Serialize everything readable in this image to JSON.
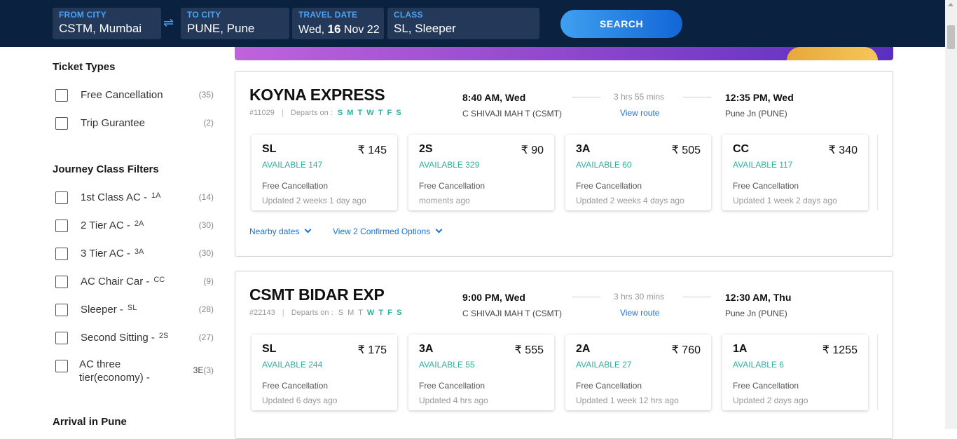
{
  "search": {
    "from": {
      "label": "FROM CITY",
      "value": "CSTM, Mumbai"
    },
    "to": {
      "label": "TO CITY",
      "value": "PUNE, Pune"
    },
    "date": {
      "label": "TRAVEL DATE",
      "prefix": "Wed,",
      "day": "16",
      "suffix": "Nov 22"
    },
    "class": {
      "label": "CLASS",
      "value": "SL, Sleeper"
    },
    "swap_icon": "⇌",
    "button_label": "SEARCH"
  },
  "filters": {
    "ticket_types": {
      "title": "Ticket Types",
      "items": [
        {
          "label": "Free Cancellation",
          "count": "(35)"
        },
        {
          "label": "Trip Gurantee",
          "count": "(2)"
        }
      ]
    },
    "journey_class": {
      "title": "Journey Class Filters",
      "items": [
        {
          "label": "1st Class AC -",
          "code": "1A",
          "count": "(14)"
        },
        {
          "label": "2 Tier AC -",
          "code": "2A",
          "count": "(30)"
        },
        {
          "label": "3 Tier AC -",
          "code": "3A",
          "count": "(30)"
        },
        {
          "label": "AC Chair Car -",
          "code": "CC",
          "count": "(9)"
        },
        {
          "label": "Sleeper -",
          "code": "SL",
          "count": "(28)"
        },
        {
          "label": "Second Sitting -",
          "code": "2S",
          "count": "(27)"
        },
        {
          "label_line1": "AC three",
          "label_line2": "tier(economy) -",
          "code": "3E",
          "count": "(3)"
        }
      ]
    },
    "arrival": {
      "title": "Arrival in Pune"
    }
  },
  "trains": [
    {
      "name": "KOYNA EXPRESS",
      "number": "#11029",
      "separator": "|",
      "departs_label": "Departs on :",
      "days": [
        "S",
        "M",
        "T",
        "W",
        "T",
        "F",
        "S"
      ],
      "days_running": [
        true,
        true,
        true,
        true,
        true,
        true,
        true
      ],
      "dep_time": "8:40 AM, Wed",
      "dep_station": "C SHIVAJI MAH T (CSMT)",
      "duration": "3 hrs 55 mins",
      "view_route": "View route",
      "arr_time": "12:35 PM, Wed",
      "arr_station": "Pune Jn (PUNE)",
      "classes": [
        {
          "name": "SL",
          "price": "₹ 145",
          "availability": "AVAILABLE 147",
          "cancellation": "Free Cancellation",
          "updated": "Updated 2 weeks 1 day ago"
        },
        {
          "name": "2S",
          "price": "₹ 90",
          "availability": "AVAILABLE 329",
          "cancellation": "Free Cancellation",
          "updated": "moments ago"
        },
        {
          "name": "3A",
          "price": "₹ 505",
          "availability": "AVAILABLE 60",
          "cancellation": "Free Cancellation",
          "updated": "Updated 2 weeks 4 days ago"
        },
        {
          "name": "CC",
          "price": "₹ 340",
          "availability": "AVAILABLE 117",
          "cancellation": "Free Cancellation",
          "updated": "Updated 1 week 2 days ago"
        }
      ],
      "nearby_dates": "Nearby dates",
      "confirmed_options": "View 2 Confirmed Options"
    },
    {
      "name": "CSMT BIDAR EXP",
      "number": "#22143",
      "separator": "|",
      "departs_label": "Departs on :",
      "days": [
        "S",
        "M",
        "T",
        "W",
        "T",
        "F",
        "S"
      ],
      "days_running": [
        false,
        false,
        false,
        true,
        false,
        false,
        false
      ],
      "dep_time": "9:00 PM, Wed",
      "dep_station": "C SHIVAJI MAH T (CSMT)",
      "duration": "3 hrs 30 mins",
      "view_route": "View route",
      "arr_time": "12:30 AM, Thu",
      "arr_station": "Pune Jn (PUNE)",
      "classes": [
        {
          "name": "SL",
          "price": "₹ 175",
          "availability": "AVAILABLE 244",
          "cancellation": "Free Cancellation",
          "updated": "Updated 6 days ago"
        },
        {
          "name": "3A",
          "price": "₹ 555",
          "availability": "AVAILABLE 55",
          "cancellation": "Free Cancellation",
          "updated": "Updated 4 hrs ago"
        },
        {
          "name": "2A",
          "price": "₹ 760",
          "availability": "AVAILABLE 27",
          "cancellation": "Free Cancellation",
          "updated": "Updated 1 week 12 hrs ago"
        },
        {
          "name": "1A",
          "price": "₹ 1255",
          "availability": "AVAILABLE 6",
          "cancellation": "Free Cancellation",
          "updated": "Updated 2 days ago"
        }
      ]
    }
  ],
  "colors": {
    "header": "#0a2240",
    "accent": "#1a73d9",
    "available": "#2ab3a0"
  }
}
